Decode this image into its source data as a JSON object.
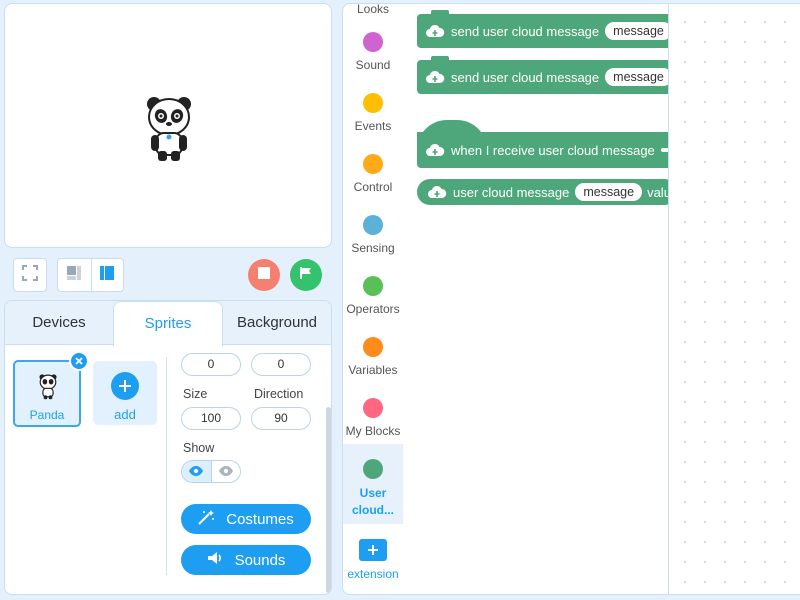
{
  "stage": {
    "fullscreen_icon": "fullscreen-icon",
    "layout_small_icon": "small-stage-layout-icon",
    "layout_large_icon": "large-stage-layout-icon",
    "stop_icon": "stop-icon",
    "go_icon": "green-flag-icon"
  },
  "sprite_panel": {
    "tabs": [
      {
        "label": "Devices"
      },
      {
        "label": "Sprites"
      },
      {
        "label": "Background"
      }
    ],
    "active_tab": "Sprites",
    "sprite": {
      "name": "Panda"
    },
    "add_label": "add",
    "x_value": "0",
    "y_value": "0",
    "size_label": "Size",
    "size_value": "100",
    "direction_label": "Direction",
    "direction_value": "90",
    "show_label": "Show",
    "costumes_label": "Costumes",
    "sounds_label": "Sounds"
  },
  "categories": {
    "items": [
      {
        "label": "Looks",
        "color": "#9a66ff"
      },
      {
        "label": "Sound",
        "color": "#cf63cf"
      },
      {
        "label": "Events",
        "color": "#ffbf00"
      },
      {
        "label": "Control",
        "color": "#ffab19"
      },
      {
        "label": "Sensing",
        "color": "#5cb1d6"
      },
      {
        "label": "Operators",
        "color": "#59c059"
      },
      {
        "label": "Variables",
        "color": "#ff8c1a"
      },
      {
        "label": "My Blocks",
        "color": "#ff6680"
      },
      {
        "label": "User cloud...",
        "color": "#4ea77a"
      }
    ],
    "extension_label": "extension"
  },
  "blocks": {
    "send1": {
      "text": "send user cloud message",
      "arg": "message"
    },
    "send2": {
      "text": "send user cloud message",
      "arg": "message"
    },
    "receive": {
      "text": "when I receive user cloud message"
    },
    "reporter": {
      "text": "user cloud message",
      "arg": "message",
      "tail": "valu"
    }
  },
  "colors": {
    "accent": "#1e9ef0",
    "block_green": "#4ea77a",
    "stop": "#f5806f",
    "go": "#34c26d"
  }
}
